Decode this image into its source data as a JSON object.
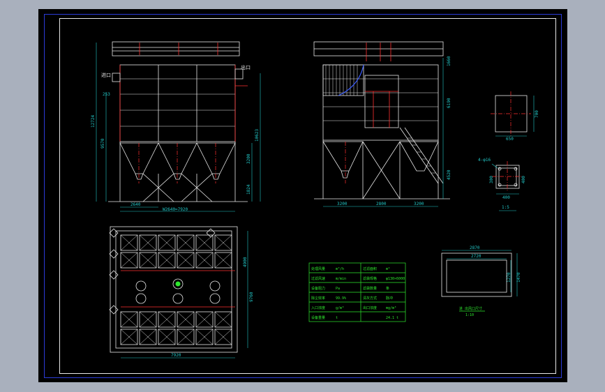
{
  "front_view": {
    "inlet_label": "进口",
    "outlet_label": "出口",
    "dims": {
      "total_height": "12724",
      "level_a": "253",
      "level_b": "9570",
      "right_height": "10623",
      "hopper_height": "3200",
      "leg_height": "1824",
      "bottom_left": "2640",
      "bottom_total": "W2640=7920"
    }
  },
  "side_view": {
    "dims": {
      "top": "1660",
      "mid": "6190",
      "low": "4520",
      "bottom_left": "3200",
      "bottom_mid": "2800",
      "bottom_right": "3200"
    }
  },
  "detail_a": {
    "height": "700",
    "width": "650"
  },
  "detail_b": {
    "callout": "4-φ16",
    "left": "300",
    "right": "400",
    "bottom": "400",
    "tag": "1:5"
  },
  "plan_view": {
    "width": "7920",
    "right_top": "4900",
    "right_bottom": "9760"
  },
  "detail_c": {
    "outer_width": "2870",
    "inner_width": "2720",
    "inner_height": "1270",
    "outer_height": "1470",
    "caption": "进 出风口尺寸",
    "scale": "1:10"
  },
  "spec_table": {
    "rows": [
      [
        "处理风量",
        "m³/h",
        "过滤面积",
        "m²"
      ],
      [
        "过滤风速",
        "m/min",
        "滤袋规格",
        "φ130×6000"
      ],
      [
        "设备阻力",
        "Pa",
        "滤袋数量",
        "条"
      ],
      [
        "除尘效率",
        "99.9%",
        "清灰方式",
        "脉冲"
      ],
      [
        "入口浓度",
        "g/m³",
        "出口浓度",
        "mg/m³"
      ],
      [
        "设备重量",
        "t",
        "",
        "24.1 t"
      ]
    ]
  }
}
